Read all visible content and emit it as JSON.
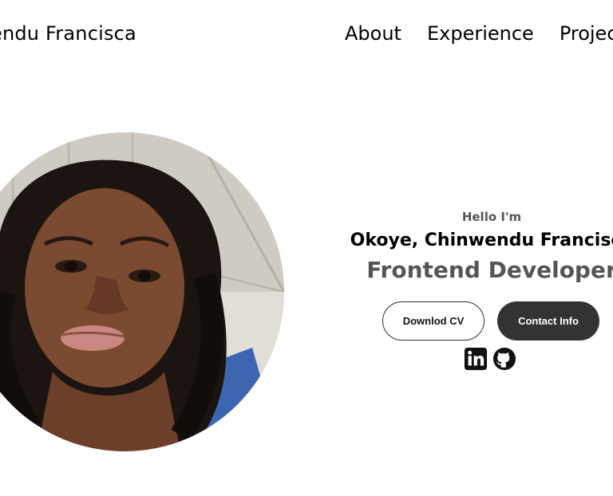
{
  "header": {
    "logo_text": "endu Francisca",
    "nav": [
      {
        "label": "About"
      },
      {
        "label": "Experience"
      },
      {
        "label": "Projec"
      }
    ]
  },
  "profile": {
    "greeting": "Hello I'm",
    "name": "Okoye, Chinwendu Francisca",
    "title": "Frontend Developer"
  },
  "buttons": {
    "download_cv": "Downlod CV",
    "contact_info": "Contact Info"
  },
  "socials": [
    {
      "icon": "linkedin-icon"
    },
    {
      "icon": "github-icon"
    }
  ],
  "colors": {
    "text": "#000000",
    "muted": "#555555",
    "dark_button": "#333333",
    "background": "#ffffff"
  }
}
